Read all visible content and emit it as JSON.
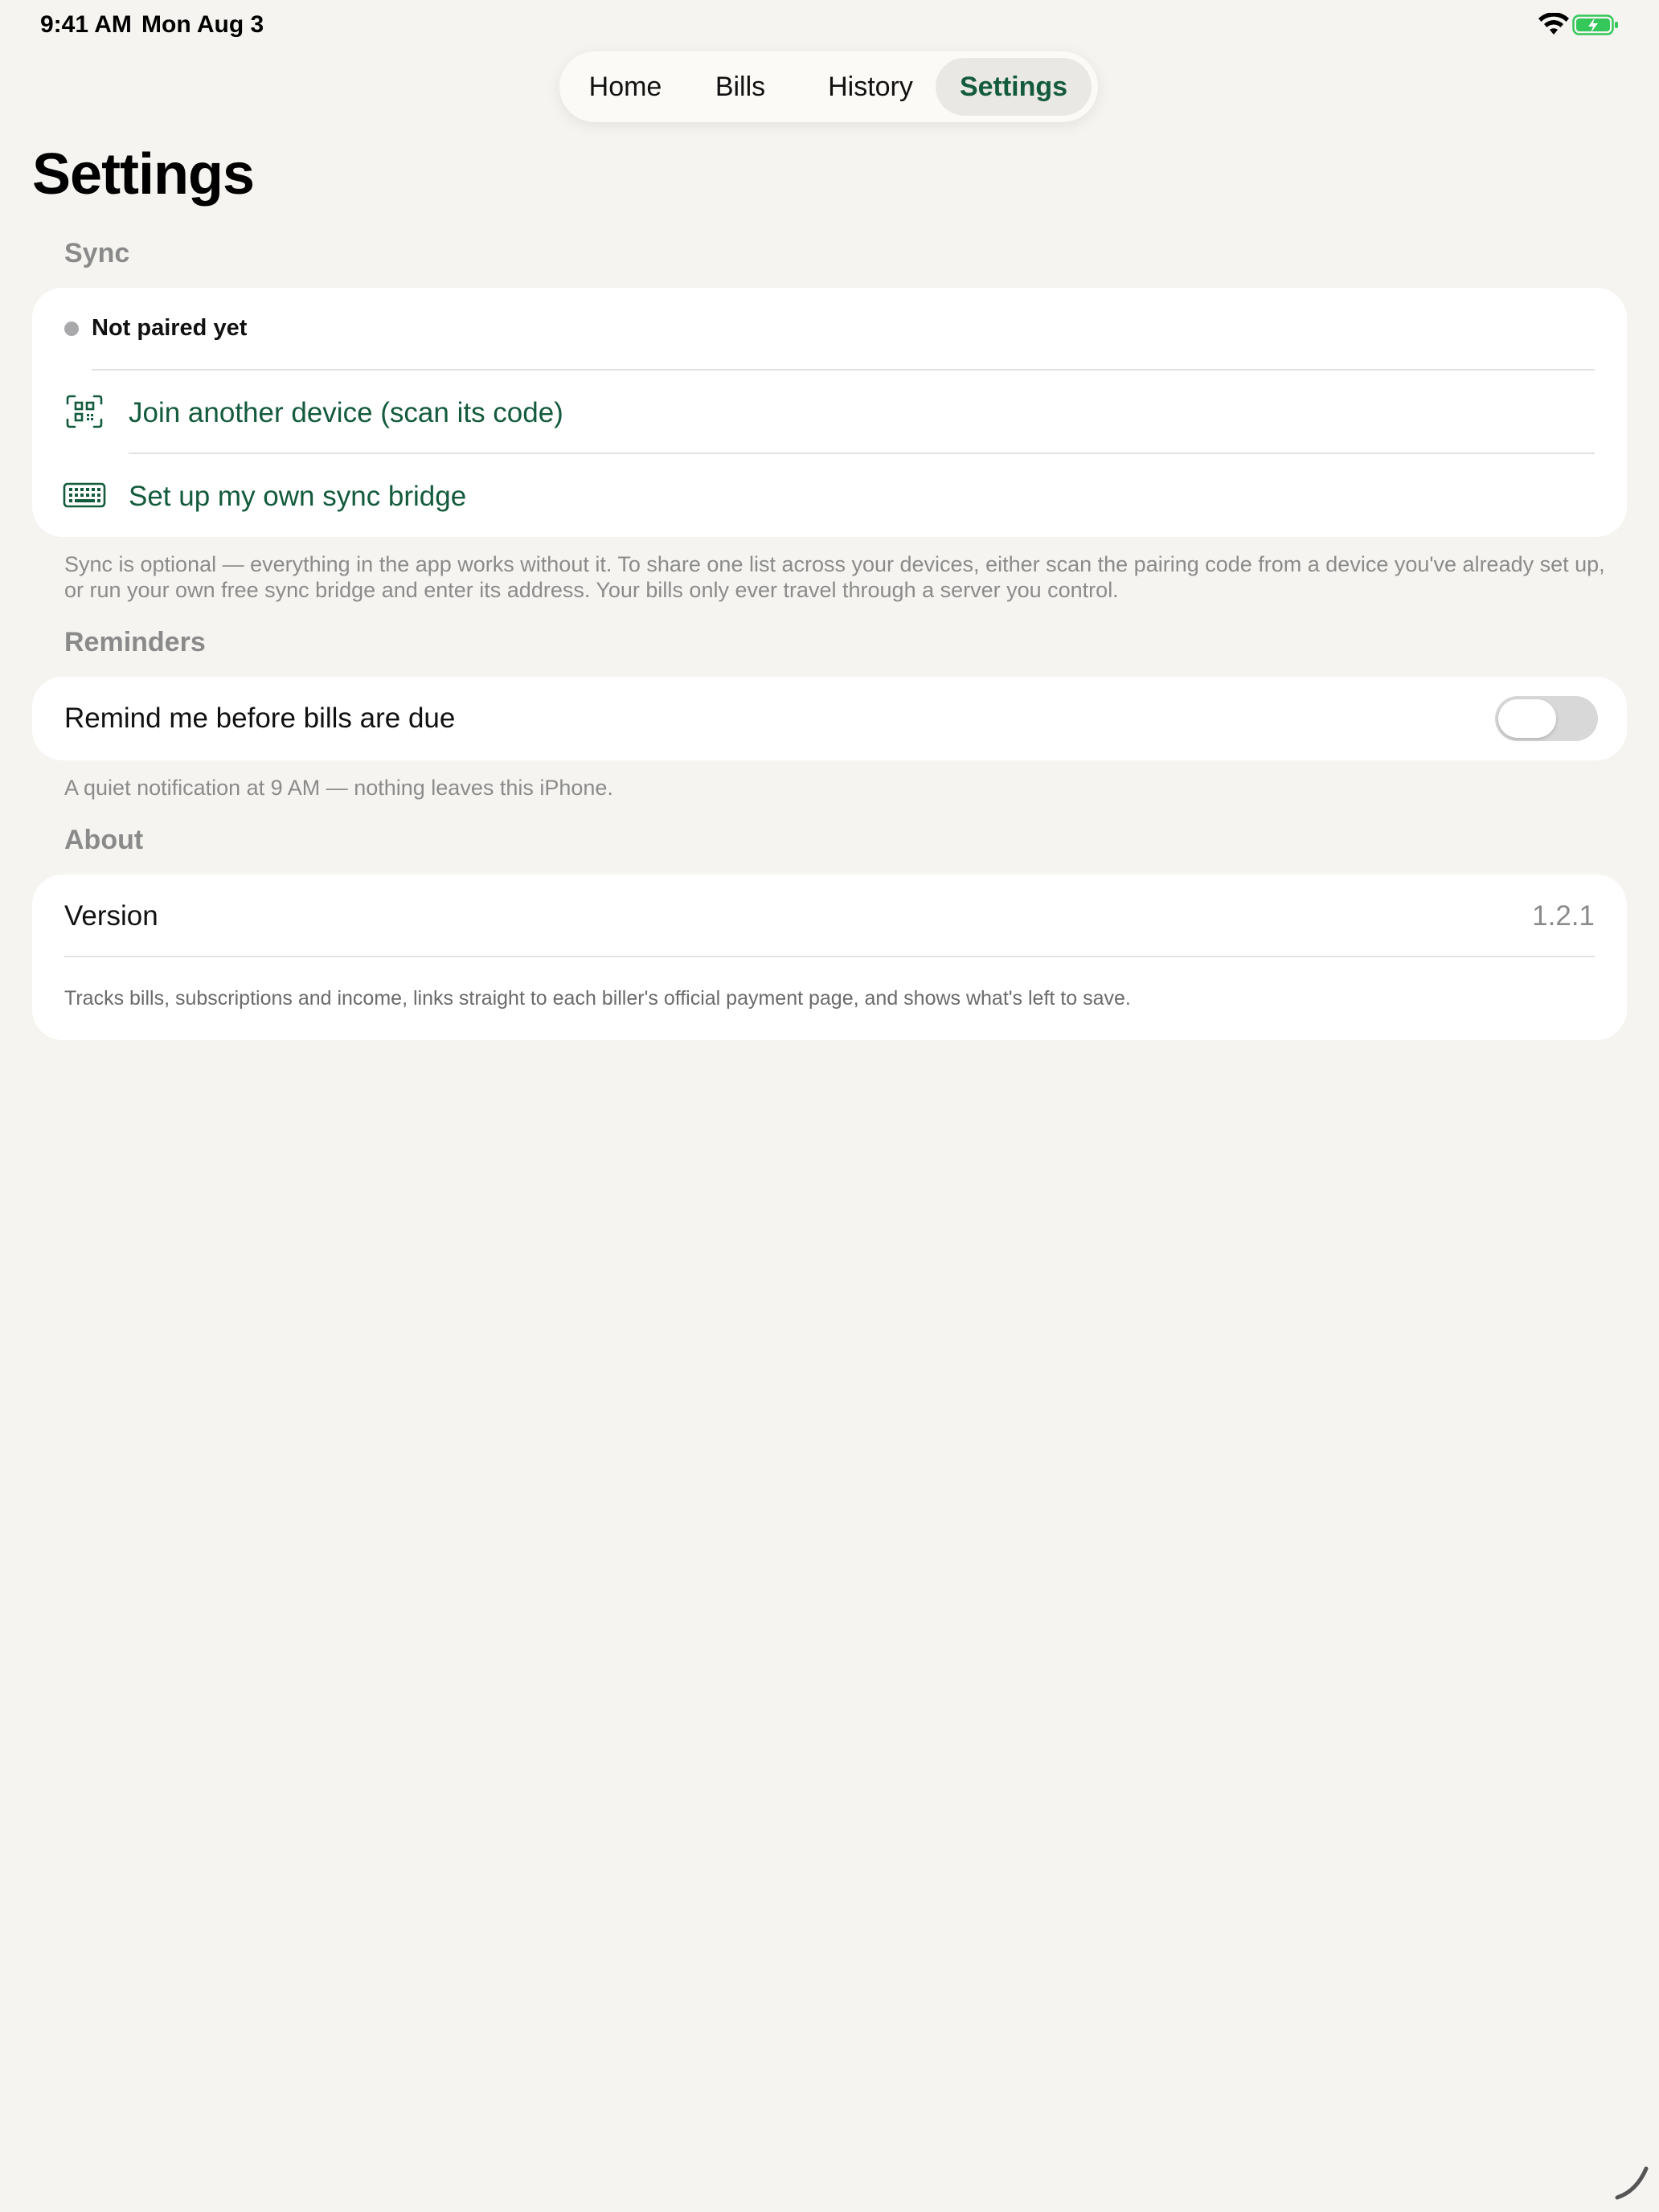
{
  "status_bar": {
    "time": "9:41 AM",
    "date": "Mon Aug 3"
  },
  "nav": {
    "tabs": [
      {
        "label": "Home"
      },
      {
        "label": "Bills"
      },
      {
        "label": "History"
      },
      {
        "label": "Settings",
        "selected": true
      }
    ]
  },
  "page": {
    "title": "Settings"
  },
  "sync": {
    "header": "Sync",
    "status": "Not paired yet",
    "join_label": "Join another device (scan its code)",
    "setup_label": "Set up my own sync bridge",
    "footer": "Sync is optional — everything in the app works without it. To share one list across your devices, either scan the pairing code from a device you've already set up, or run your own free sync bridge and enter its address. Your bills only ever travel through a server you control."
  },
  "reminders": {
    "header": "Reminders",
    "toggle_label": "Remind me before bills are due",
    "toggle_on": false,
    "footer": "A quiet notification at 9 AM — nothing leaves this iPhone."
  },
  "about": {
    "header": "About",
    "version_label": "Version",
    "version_value": "1.2.1",
    "description": "Tracks bills, subscriptions and income, links straight to each biller's official payment page, and shows what's left to save."
  },
  "icons": {
    "join": "qr-scan-icon",
    "setup": "keyboard-icon",
    "wifi": "wifi-icon",
    "battery": "battery-charging-icon"
  },
  "colors": {
    "accent": "#135b3c",
    "background": "#f5f4f1",
    "card": "#ffffff",
    "secondary_text": "#8b8b8b",
    "battery": "#34c759"
  }
}
